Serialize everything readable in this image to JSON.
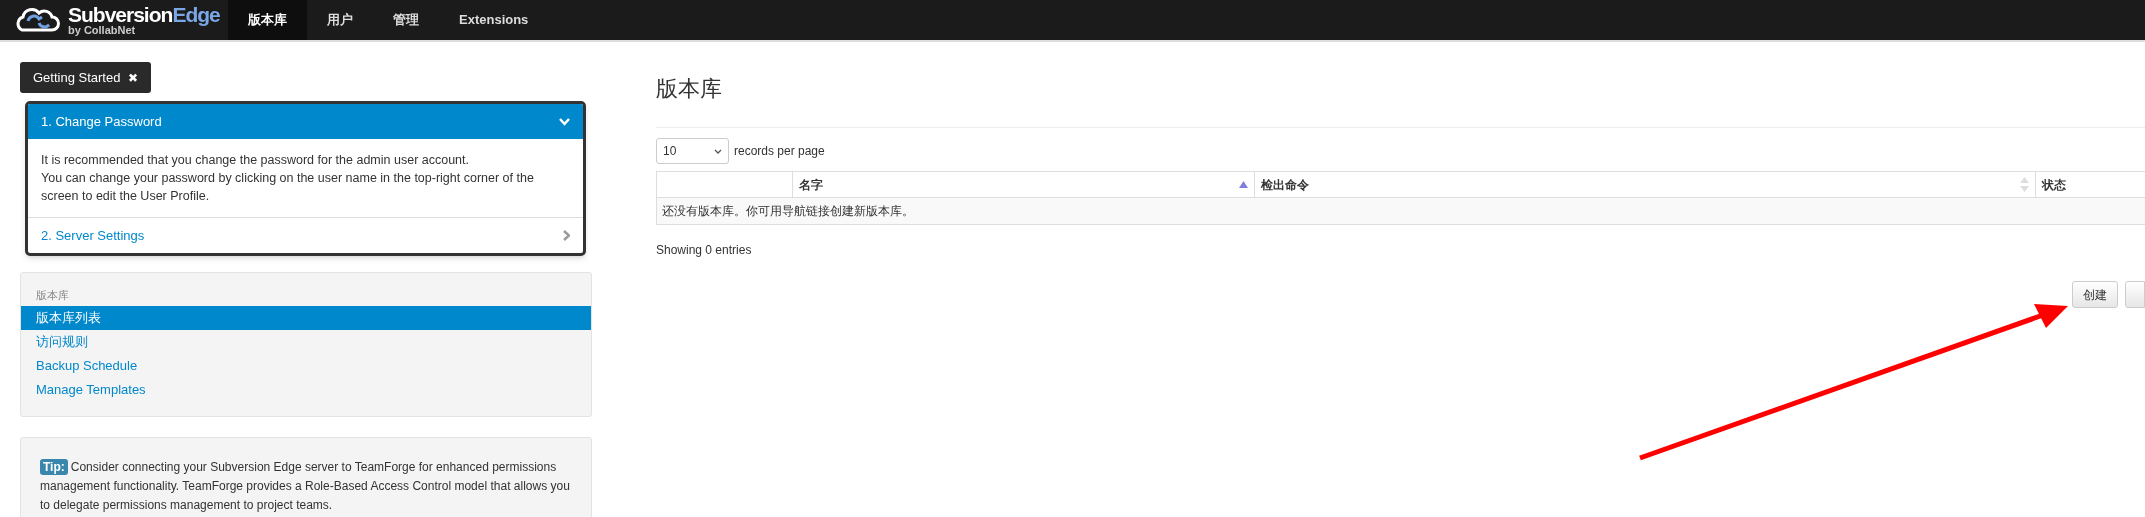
{
  "brand": {
    "name": "Subversion",
    "name_accent": "Edge",
    "byline": "by CollabNet"
  },
  "nav": [
    {
      "label": "版本库",
      "selected": true
    },
    {
      "label": "用户",
      "selected": false
    },
    {
      "label": "管理",
      "selected": false
    },
    {
      "label": "Extensions",
      "selected": false
    }
  ],
  "getting_started": {
    "label": "Getting Started",
    "close": "✖",
    "steps": [
      {
        "title": "1. Change Password",
        "expanded": true,
        "body": [
          "It is recommended that you change the password for the admin user account.",
          "You can change your password by clicking on the user name in the top-right corner of the screen to edit the User Profile."
        ]
      },
      {
        "title": "2. Server Settings",
        "expanded": false
      }
    ]
  },
  "sidebar": {
    "heading": "版本库",
    "items": [
      {
        "label": "版本库列表",
        "selected": true
      },
      {
        "label": "访问规则",
        "selected": false
      },
      {
        "label": "Backup Schedule",
        "selected": false
      },
      {
        "label": "Manage Templates",
        "selected": false
      }
    ]
  },
  "tip": {
    "badge": "Tip:",
    "text": "Consider connecting your Subversion Edge server to TeamForge for enhanced permissions management functionality. TeamForge provides a Role-Based Access Control model that allows you to delegate permissions management to project teams."
  },
  "main": {
    "title": "版本库",
    "page_size": "10",
    "page_size_label": "records per page",
    "table": {
      "columns": [
        {
          "label": "名字",
          "sortable": true,
          "sorted": true
        },
        {
          "label": "检出命令",
          "sortable": true,
          "sorted": false
        },
        {
          "label": "状态"
        }
      ],
      "empty_message": "还没有版本库。你可用导航链接创建新版本库。"
    },
    "showing": "Showing 0 entries",
    "buttons": [
      "创建"
    ]
  }
}
